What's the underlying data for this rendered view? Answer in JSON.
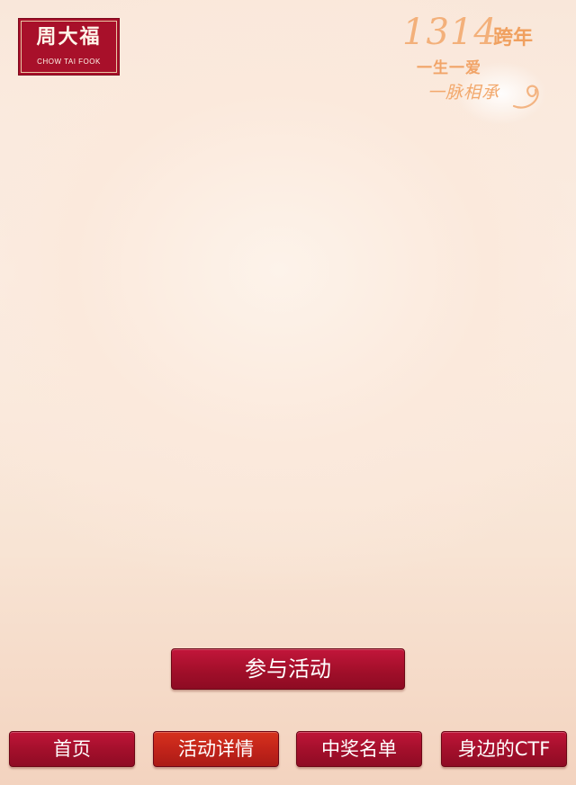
{
  "brand": {
    "name_cn": "周大福",
    "name_en": "CHOW TAI FOOK"
  },
  "campaign": {
    "number": "1314",
    "suffix": "跨年",
    "line2": "一生一爱",
    "line3": "一脉相承"
  },
  "actions": {
    "join_label": "参与活动"
  },
  "nav": {
    "items": [
      {
        "label": "首页",
        "active": false
      },
      {
        "label": "活动详情",
        "active": true
      },
      {
        "label": "中奖名单",
        "active": false
      },
      {
        "label": "身边的CTF",
        "active": false
      }
    ]
  },
  "colors": {
    "brand_red": "#a8102a",
    "active_red": "#c0231a",
    "accent_orange": "#f0a05f",
    "background": "#fbeee4"
  }
}
